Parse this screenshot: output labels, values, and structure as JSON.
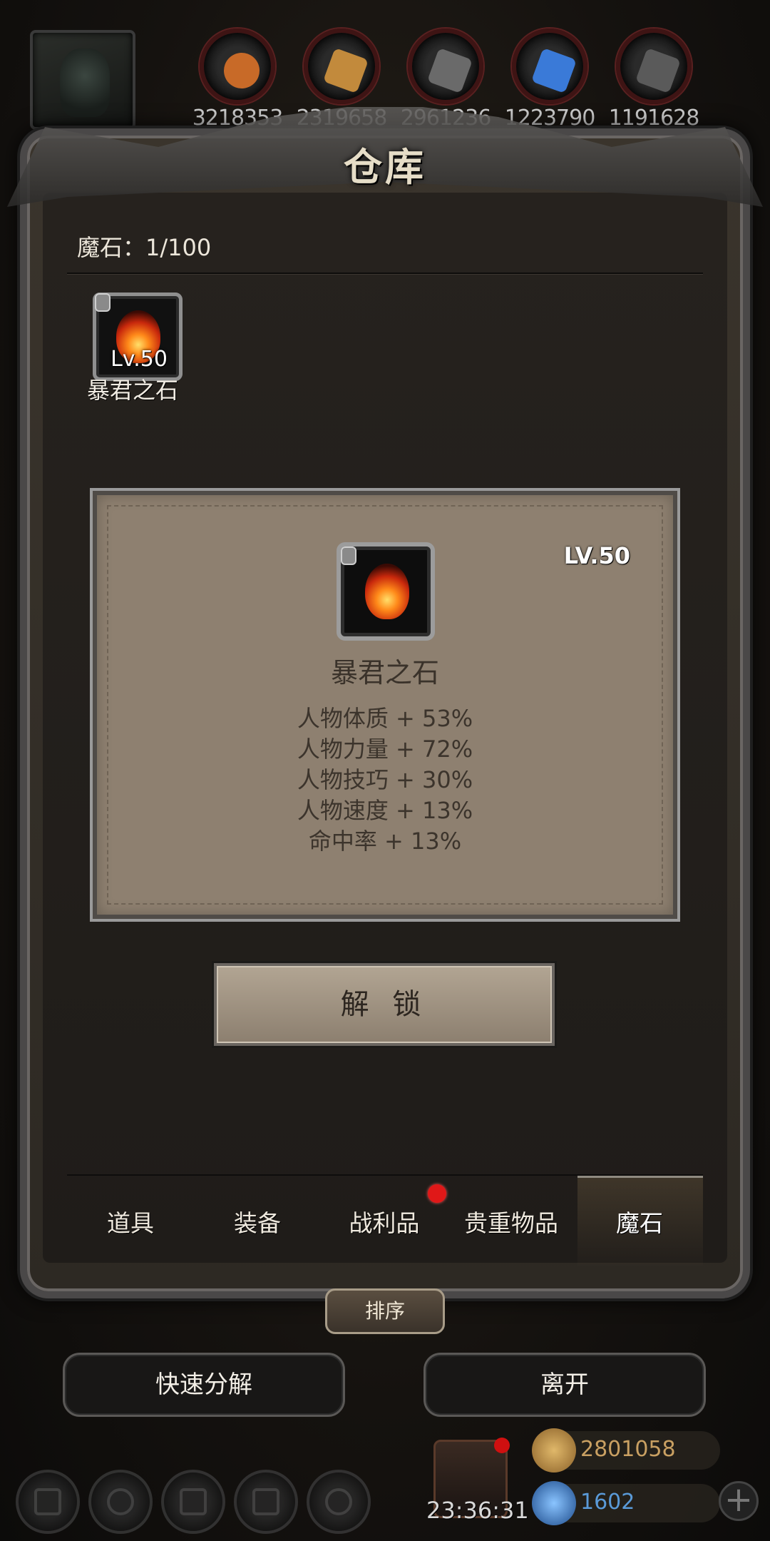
{
  "resources": [
    {
      "icon": "copper-ore-icon",
      "value": "3218353",
      "color": "#c86a28"
    },
    {
      "icon": "wood-plank-icon",
      "value": "2319658",
      "color": "#c28a3c"
    },
    {
      "icon": "iron-ingot-icon",
      "value": "2961236",
      "color": "#6a6a6a"
    },
    {
      "icon": "crystal-icon",
      "value": "1223790",
      "color": "#3a7ad8"
    },
    {
      "icon": "steel-bar-icon",
      "value": "1191628",
      "color": "#5a5a5a"
    }
  ],
  "window": {
    "title": "仓库"
  },
  "storage": {
    "label": "魔石：1/100"
  },
  "items": [
    {
      "name": "暴君之石",
      "level": "Lv.50",
      "locked": true
    }
  ],
  "detail": {
    "level": "LV.50",
    "name": "暴君之石",
    "stats": [
      "人物体质 + 53%",
      "人物力量 + 72%",
      "人物技巧 + 30%",
      "人物速度 + 13%",
      "命中率 + 13%"
    ],
    "action_label": "解 锁"
  },
  "tabs": [
    {
      "label": "道具",
      "active": false
    },
    {
      "label": "装备",
      "active": false
    },
    {
      "label": "战利品",
      "active": false,
      "badge": true
    },
    {
      "label": "贵重物品",
      "active": false
    },
    {
      "label": "魔石",
      "active": true
    }
  ],
  "buttons": {
    "sort": "排序",
    "quick_decompose": "快速分解",
    "leave": "离开"
  },
  "footer": {
    "timer": "23:36:31",
    "gold": "2801058",
    "gems": "1602",
    "gold_color": "#c9a062",
    "gem_color": "#5a9ad8"
  },
  "colors": {
    "card_bg": "#8e8070",
    "frame": "#4a4848",
    "accent_red": "#e01818"
  }
}
